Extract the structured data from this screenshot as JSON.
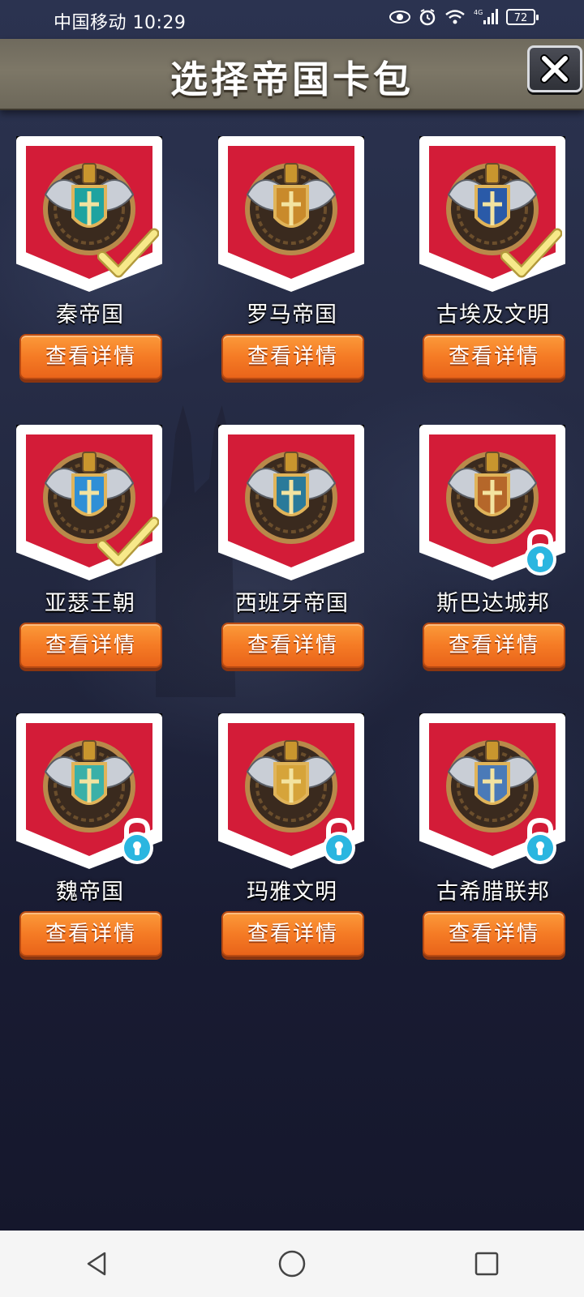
{
  "status_bar": {
    "carrier_time": "中国移动 10:29",
    "battery": "72",
    "icons": [
      "eye-icon",
      "alarm-icon",
      "wifi-icon",
      "4g-signal-icon",
      "battery-icon"
    ]
  },
  "header": {
    "title": "选择帝国卡包",
    "close_icon": "close-icon"
  },
  "cards": [
    {
      "name": "秦帝国",
      "button": "查看详情",
      "state": "selected",
      "emblem": "sword-shield-emblem-icon"
    },
    {
      "name": "罗马帝国",
      "button": "查看详情",
      "state": "available",
      "emblem": "roman-helmet-emblem-icon"
    },
    {
      "name": "古埃及文明",
      "button": "查看详情",
      "state": "selected",
      "emblem": "eye-pyramid-emblem-icon"
    },
    {
      "name": "亚瑟王朝",
      "button": "查看详情",
      "state": "selected",
      "emblem": "winged-cross-shield-emblem-icon"
    },
    {
      "name": "西班牙帝国",
      "button": "查看详情",
      "state": "available",
      "emblem": "crowned-cross-shield-emblem-icon"
    },
    {
      "name": "斯巴达城邦",
      "button": "查看详情",
      "state": "locked",
      "emblem": "spartan-helmet-emblem-icon"
    },
    {
      "name": "魏帝国",
      "button": "查看详情",
      "state": "locked",
      "emblem": "horse-head-emblem-icon"
    },
    {
      "name": "玛雅文明",
      "button": "查看详情",
      "state": "locked",
      "emblem": "mayan-mask-emblem-icon"
    },
    {
      "name": "古希腊联邦",
      "button": "查看详情",
      "state": "locked",
      "emblem": "greek-helmet-emblem-icon"
    }
  ],
  "colors": {
    "badge_red": "#d31c38",
    "button_orange": "#f57b25",
    "check_yellow": "#f4e27a",
    "lock_cyan": "#2bb6e0"
  },
  "nav_bar": {
    "icons": [
      "back-triangle-icon",
      "home-circle-icon",
      "recents-square-icon"
    ]
  }
}
